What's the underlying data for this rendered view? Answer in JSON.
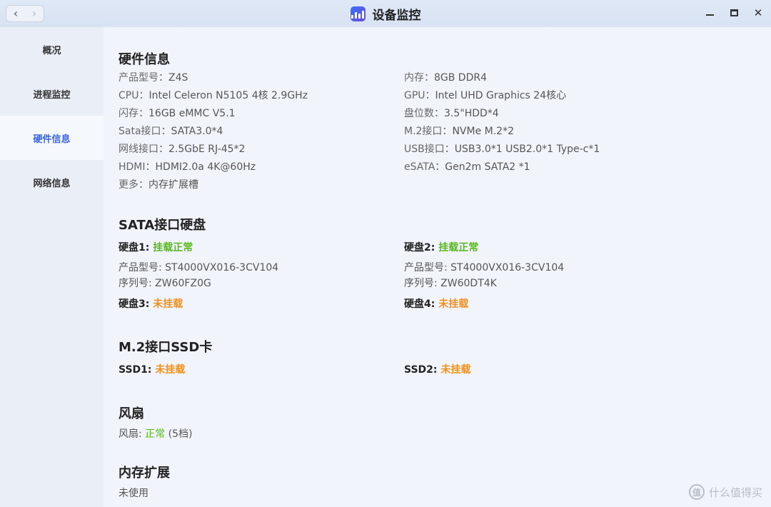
{
  "titlebar": {
    "title": "设备监控",
    "back_glyph": "‹",
    "forward_glyph": "›"
  },
  "sidebar": {
    "items": [
      {
        "label": "概况"
      },
      {
        "label": "进程监控"
      },
      {
        "label": "硬件信息",
        "active": true
      },
      {
        "label": "网络信息"
      }
    ]
  },
  "hardware": {
    "title": "硬件信息",
    "left": [
      {
        "label": "产品型号：",
        "value": "Z4S"
      },
      {
        "label": "CPU：",
        "value": "Intel Celeron N5105 4核 2.9GHz"
      },
      {
        "label": "闪存：",
        "value": "16GB eMMC V5.1"
      },
      {
        "label": "Sata接口：",
        "value": "SATA3.0*4"
      },
      {
        "label": "网线接口：",
        "value": "2.5GbE RJ-45*2"
      },
      {
        "label": "HDMI：",
        "value": "HDMI2.0a 4K@60Hz"
      },
      {
        "label": "更多：",
        "value": "内存扩展槽"
      }
    ],
    "right": [
      {
        "label": "内存：",
        "value": "8GB DDR4"
      },
      {
        "label": "GPU：",
        "value": "Intel UHD Graphics 24核心"
      },
      {
        "label": "盘位数：",
        "value": "3.5\"HDD*4"
      },
      {
        "label": "M.2接口：",
        "value": "NVMe M.2*2"
      },
      {
        "label": "USB接口：",
        "value": "USB3.0*1 USB2.0*1 Type-c*1"
      },
      {
        "label": "eSATA：",
        "value": "Gen2m SATA2 *1"
      }
    ]
  },
  "sata": {
    "title": "SATA接口硬盘",
    "disks": [
      {
        "name": "硬盘1:",
        "status": "挂载正常",
        "model_label": "产品型号:",
        "model": "ST4000VX016-3CV104",
        "serial_label": "序列号:",
        "serial": "ZW60FZ0G"
      },
      {
        "name": "硬盘2:",
        "status": "挂载正常",
        "model_label": "产品型号:",
        "model": "ST4000VX016-3CV104",
        "serial_label": "序列号:",
        "serial": "ZW60DT4K"
      },
      {
        "name": "硬盘3:",
        "status": "未挂载"
      },
      {
        "name": "硬盘4:",
        "status": "未挂载"
      }
    ]
  },
  "m2": {
    "title": "M.2接口SSD卡",
    "ssds": [
      {
        "name": "SSD1:",
        "status": "未挂载"
      },
      {
        "name": "SSD2:",
        "status": "未挂载"
      }
    ]
  },
  "fan": {
    "title": "风扇",
    "label": "风扇:",
    "status": "正常",
    "detail": "(5档)"
  },
  "memory": {
    "title": "内存扩展",
    "status": "未使用"
  },
  "watermark": {
    "logo": "值",
    "text": "什么值得买"
  },
  "colors": {
    "ok": "#58b81c",
    "warn": "#f0901e",
    "accent": "#3a64e0"
  }
}
